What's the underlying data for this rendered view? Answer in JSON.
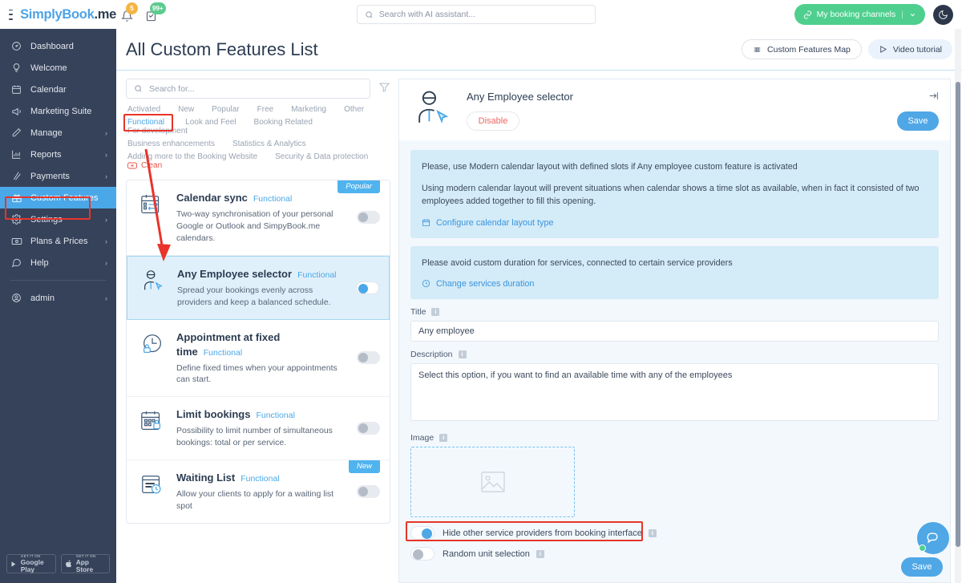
{
  "topbar": {
    "brand_prefix": "S",
    "brand_first": "implyBook",
    "brand_second": ".me",
    "menu_icon": "hamburger-icon",
    "bell_badge": "5",
    "tasks_badge": "99+",
    "search_placeholder": "Search with AI assistant...",
    "booking_channels_label": "My booking channels",
    "theme_toggle": "dark-mode-icon"
  },
  "sidebar": {
    "items": [
      {
        "label": "Dashboard",
        "icon": "dashboard-icon",
        "chevron": false,
        "active": false
      },
      {
        "label": "Welcome",
        "icon": "bulb-icon",
        "chevron": false,
        "active": false
      },
      {
        "label": "Calendar",
        "icon": "calendar-icon",
        "chevron": false,
        "active": false
      },
      {
        "label": "Marketing Suite",
        "icon": "megaphone-icon",
        "chevron": false,
        "active": false
      },
      {
        "label": "Manage",
        "icon": "pencil-icon",
        "chevron": true,
        "active": false
      },
      {
        "label": "Reports",
        "icon": "chart-icon",
        "chevron": true,
        "active": false
      },
      {
        "label": "Payments",
        "icon": "payments-icon",
        "chevron": true,
        "active": false
      },
      {
        "label": "Custom Features",
        "icon": "gift-icon",
        "chevron": false,
        "active": true
      },
      {
        "label": "Settings",
        "icon": "gear-icon",
        "chevron": true,
        "active": false
      },
      {
        "label": "Plans & Prices",
        "icon": "money-icon",
        "chevron": true,
        "active": false
      },
      {
        "label": "Help",
        "icon": "chat-icon",
        "chevron": true,
        "active": false
      }
    ],
    "account": {
      "label": "admin",
      "icon": "user-circle-icon",
      "chevron": true
    },
    "stores": [
      {
        "top": "GET IT ON",
        "name": "Google Play",
        "icon": "google-play-icon"
      },
      {
        "top": "GET IT ON",
        "name": "App Store",
        "icon": "apple-icon"
      }
    ]
  },
  "page": {
    "title": "All Custom Features List",
    "actions": [
      {
        "label": "Custom Features Map",
        "icon": "map-grid-icon",
        "style": "outline"
      },
      {
        "label": "Video tutorial",
        "icon": "play-icon",
        "style": "soft"
      }
    ]
  },
  "list_panel": {
    "search_placeholder": "Search for...",
    "filter_icon": "funnel-icon",
    "tag_rows": [
      [
        {
          "label": "Activated",
          "type": "plain"
        },
        {
          "label": "New",
          "type": "plain"
        },
        {
          "label": "Popular",
          "type": "plain"
        },
        {
          "label": "Free",
          "type": "plain"
        },
        {
          "label": "Marketing",
          "type": "plain"
        },
        {
          "label": "Other",
          "type": "plain"
        }
      ],
      [
        {
          "label": "Functional",
          "type": "selected"
        },
        {
          "label": "Look and Feel",
          "type": "plain"
        },
        {
          "label": "Booking Related",
          "type": "plain"
        },
        {
          "label": "For development",
          "type": "plain"
        }
      ],
      [
        {
          "label": "Business enhancements",
          "type": "plain"
        },
        {
          "label": "Statistics & Analytics",
          "type": "plain"
        }
      ],
      [
        {
          "label": "Adding more to the Booking Website",
          "type": "plain"
        },
        {
          "label": "Security & Data protection",
          "type": "plain"
        },
        {
          "label": "Clean",
          "type": "clear"
        }
      ]
    ],
    "cards": [
      {
        "title": "Calendar sync",
        "tag": "Functional",
        "desc": "Two-way synchronisation of your personal Google or Outlook and SimpyBook.me calendars.",
        "badge": "Popular",
        "badge_kind": "popular",
        "enabled": false,
        "selected": false,
        "icon": "calendar-sync-icon"
      },
      {
        "title": "Any Employee selector",
        "tag": "Functional",
        "desc": "Spread your bookings evenly across providers and keep a balanced schedule.",
        "badge": "",
        "badge_kind": "",
        "enabled": true,
        "selected": true,
        "icon": "employee-selector-icon"
      },
      {
        "title": "Appointment at fixed time",
        "tag": "Functional",
        "desc": "Define fixed times when your appointments can start.",
        "badge": "",
        "badge_kind": "",
        "enabled": false,
        "selected": false,
        "icon": "clock-lock-icon"
      },
      {
        "title": "Limit bookings",
        "tag": "Functional",
        "desc": "Possibility to limit number of simultaneous bookings: total or per service.",
        "badge": "",
        "badge_kind": "",
        "enabled": false,
        "selected": false,
        "icon": "limit-bookings-icon"
      },
      {
        "title": "Waiting List",
        "tag": "Functional",
        "desc": "Allow your clients to apply for a waiting list spot",
        "badge": "New",
        "badge_kind": "new",
        "enabled": false,
        "selected": false,
        "icon": "waiting-list-icon"
      }
    ]
  },
  "detail": {
    "icon": "employee-selector-icon",
    "title": "Any Employee selector",
    "disable_label": "Disable",
    "save_label": "Save",
    "collapse_icon": "collapse-panel-icon",
    "notices": [
      {
        "paragraphs": [
          "Please, use Modern calendar layout with defined slots if Any employee custom feature is activated",
          "Using modern calendar layout will prevent situations when calendar shows a time slot as available, when in fact it consisted of two employees added together to fill this opening."
        ],
        "link_label": "Configure calendar layout type",
        "link_icon": "calendar-icon"
      },
      {
        "paragraphs": [
          "Please avoid custom duration for services, connected to certain service providers"
        ],
        "link_label": "Change services duration",
        "link_icon": "clock-icon"
      }
    ],
    "title_field": {
      "label": "Title",
      "value": "Any employee",
      "info_icon": "info-icon"
    },
    "description_field": {
      "label": "Description",
      "value": "Select this option, if you want to find an available time with any of the employees",
      "info_icon": "info-icon"
    },
    "image_field": {
      "label": "Image",
      "info_icon": "info-icon",
      "placeholder_icon": "image-placeholder-icon"
    },
    "switches": [
      {
        "label": "Hide other service providers from booking interface",
        "on": true,
        "info_icon": "info-icon",
        "highlighted": true
      },
      {
        "label": "Random unit selection",
        "on": false,
        "info_icon": "info-icon",
        "highlighted": false
      }
    ]
  },
  "floating": {
    "chat_icon": "chat-bubbles-icon",
    "save_label": "Save"
  },
  "colors": {
    "accent_blue": "#4aa8e8",
    "sidebar_bg": "#36425a",
    "green": "#4fcf8e",
    "highlight_red": "#e8342a",
    "notice_bg": "#d4ebf8",
    "selected_card": "#e0f0fb"
  }
}
